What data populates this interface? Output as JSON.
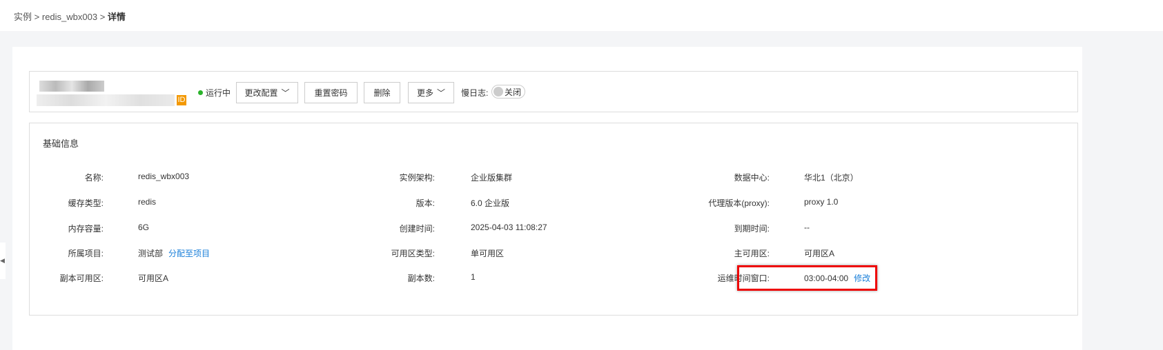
{
  "breadcrumb": {
    "item1": "实例",
    "sep": ">",
    "item2": "redis_wbx003",
    "item3": "详情"
  },
  "header": {
    "id_badge": "ID",
    "status": "运行中",
    "buttons": {
      "change_config": "更改配置",
      "reset_password": "重置密码",
      "delete": "删除",
      "more": "更多"
    },
    "slow_log_label": "慢日志:",
    "slow_log_toggle": "关闭"
  },
  "info": {
    "title": "基础信息",
    "rows": [
      [
        {
          "label": "名称:",
          "value": "redis_wbx003"
        },
        {
          "label": "实例架构:",
          "value": "企业版集群"
        },
        {
          "label": "数据中心:",
          "value": "华北1（北京）"
        }
      ],
      [
        {
          "label": "缓存类型:",
          "value": "redis"
        },
        {
          "label": "版本:",
          "value": "6.0 企业版"
        },
        {
          "label": "代理版本(proxy):",
          "value": "proxy 1.0"
        }
      ],
      [
        {
          "label": "内存容量:",
          "value": "6G"
        },
        {
          "label": "创建时间:",
          "value": "2025-04-03 11:08:27"
        },
        {
          "label": "到期时间:",
          "value": "--"
        }
      ],
      [
        {
          "label": "所属项目:",
          "value": "测试部",
          "link": "分配至项目"
        },
        {
          "label": "可用区类型:",
          "value": "单可用区"
        },
        {
          "label": "主可用区:",
          "value": "可用区A"
        }
      ],
      [
        {
          "label": "副本可用区:",
          "value": "可用区A"
        },
        {
          "label": "副本数:",
          "value": "1"
        },
        {
          "label": "运维时间窗口:",
          "value": "03:00-04:00",
          "link": "修改"
        }
      ]
    ]
  },
  "colors": {
    "accent": "#1a7fd9",
    "running": "#2ab32a",
    "highlight": "#e00000",
    "id_badge": "#f39800"
  }
}
